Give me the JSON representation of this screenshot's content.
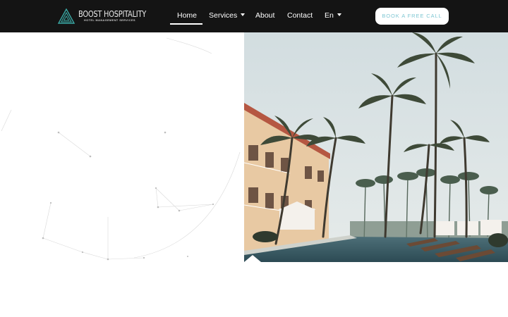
{
  "header": {
    "logo": {
      "title": "BOOST HOSPITALITY",
      "subtitle": "HOTEL MANAGEMENT SERVICES"
    },
    "nav": [
      {
        "label": "Home",
        "active": true,
        "has_dropdown": false
      },
      {
        "label": "Services",
        "active": false,
        "has_dropdown": true
      },
      {
        "label": "About",
        "active": false,
        "has_dropdown": false
      },
      {
        "label": "Contact",
        "active": false,
        "has_dropdown": false
      },
      {
        "label": "En",
        "active": false,
        "has_dropdown": true
      }
    ],
    "cta_label": "BOOK A FREE CALL"
  },
  "colors": {
    "header_bg": "#141414",
    "accent": "#7fc7d3",
    "logo_teal": "#3aa7a3"
  },
  "hero": {
    "image": "resort-pool-palm-trees-photo",
    "background": "network-lines-pattern"
  }
}
